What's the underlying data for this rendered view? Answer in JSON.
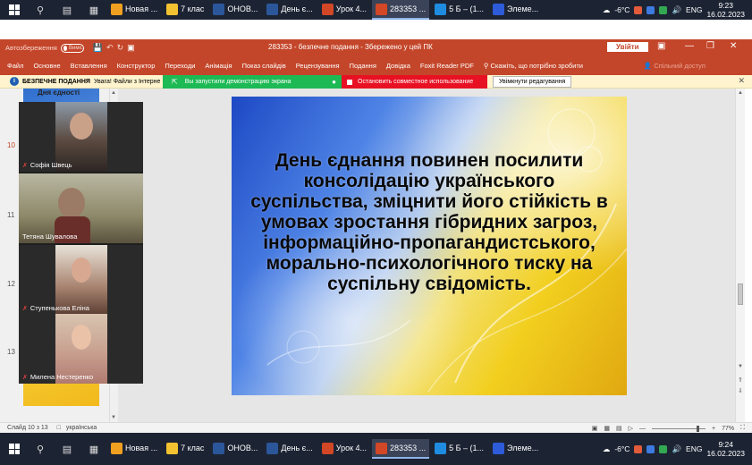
{
  "taskbar_top": {
    "apps": [
      {
        "label": "Новая ...",
        "color": "#f0a020"
      },
      {
        "label": "7 клас",
        "color": "#f2c230"
      },
      {
        "label": "ОНОВ...",
        "color": "#2b579a"
      },
      {
        "label": "День є...",
        "color": "#2b579a"
      },
      {
        "label": "Урок 4...",
        "color": "#d24726"
      },
      {
        "label": "283353 ...",
        "color": "#d24726"
      },
      {
        "label": "5 Б – (1...",
        "color": "#1f8ce0"
      },
      {
        "label": "Элеме...",
        "color": "#2d5bd9"
      }
    ],
    "weather": "-6°C",
    "lang": "ENG",
    "time": "9:23",
    "date": "16.02.2023"
  },
  "taskbar_bottom": {
    "apps": [
      {
        "label": "Новая ...",
        "color": "#f0a020"
      },
      {
        "label": "7 клас",
        "color": "#f2c230"
      },
      {
        "label": "ОНОВ...",
        "color": "#2b579a"
      },
      {
        "label": "День є...",
        "color": "#2b579a"
      },
      {
        "label": "Урок 4...",
        "color": "#d24726"
      },
      {
        "label": "283353 ...",
        "color": "#d24726"
      },
      {
        "label": "5 Б – (1...",
        "color": "#1f8ce0"
      },
      {
        "label": "Элеме...",
        "color": "#2d5bd9"
      }
    ],
    "weather": "-6°C",
    "lang": "ENG",
    "time": "9:24",
    "date": "16.02.2023"
  },
  "titlebar": {
    "autosave_label": "Автозбереження",
    "autosave_state": "Вимк.",
    "title": "283353 - безпечне подання - Збережено у цей ПК",
    "signin": "Увійти",
    "accent": "#c4462a"
  },
  "ribbon": {
    "tabs": [
      "Файл",
      "Основне",
      "Вставлення",
      "Конструктор",
      "Переходи",
      "Анімація",
      "Показ слайдів",
      "Рецензування",
      "Подання",
      "Довідка",
      "Foxit Reader PDF"
    ],
    "tell_me": "Скажіть, що потрібно зробити",
    "share": "Спільний доступ"
  },
  "protected_bar": {
    "label": "БЕЗПЕЧНЕ ПОДАННЯ",
    "message": "Увага! Файли з Інтерне",
    "sharing_notice": "Вы запустили демонстрацию экрана",
    "stop_sharing": "Остановить совместное использование",
    "enable_editing": "Увімкнути редагування"
  },
  "thumbnails": {
    "top_label": "Дня єдності",
    "numbers": [
      "10",
      "11",
      "12",
      "13"
    ]
  },
  "video": {
    "participants": [
      {
        "name": "Софія Швець",
        "bg": "#3b2f2a"
      },
      {
        "name": "Тетяна Шувалова",
        "bg": "#6b6a4a"
      },
      {
        "name": "Ступенькова Еліна",
        "bg": "#8a6b5a"
      },
      {
        "name": "Милена Нестеренко",
        "bg": "#b08a7a"
      }
    ]
  },
  "slide": {
    "text": "День єднання повинен посилити консолідацію українського суспільства, зміцнити його стійкість в умовах зростання гібридних загроз, інформаційно-пропагандистського, морально-психологічного тиску на суспільну свідомість."
  },
  "statusbar": {
    "slide_info": "Слайд 10 з 13",
    "language": "українська",
    "zoom": "77%",
    "zoom_fraction": 0.77
  }
}
